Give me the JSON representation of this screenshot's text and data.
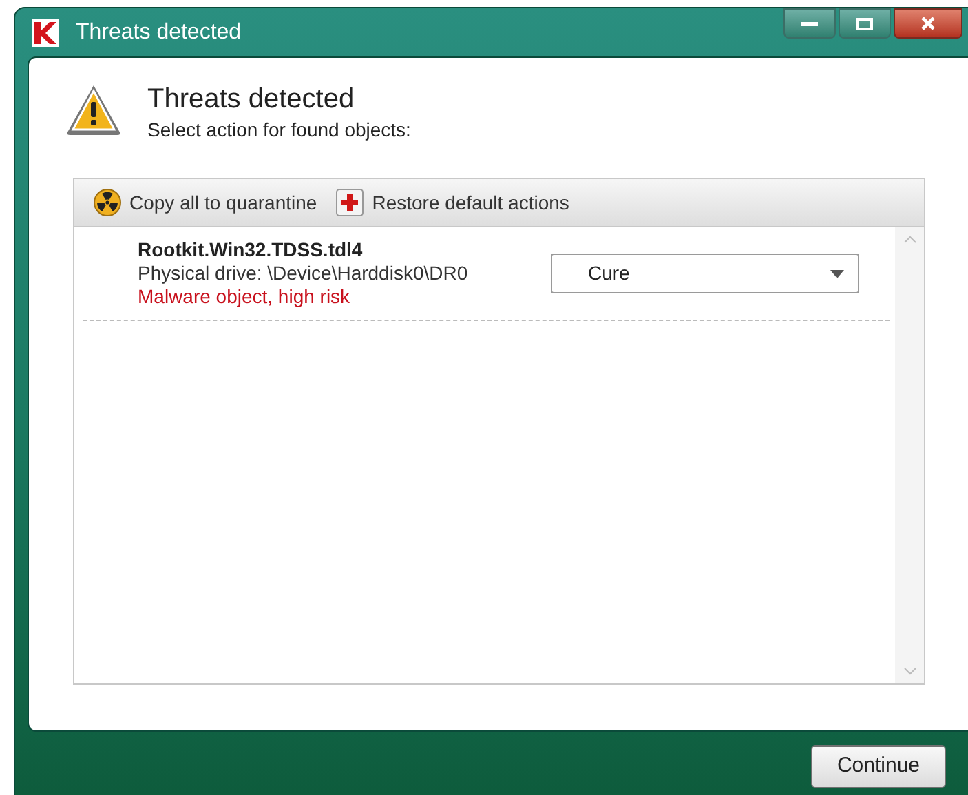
{
  "window": {
    "title": "Threats detected"
  },
  "header": {
    "title": "Threats detected",
    "subtitle": "Select action for found objects:"
  },
  "toolbar": [
    {
      "kind": "quarantine",
      "label": "Copy all to quarantine"
    },
    {
      "kind": "restore",
      "label": "Restore default actions"
    }
  ],
  "threats": [
    {
      "name": "Rootkit.Win32.TDSS.tdl4",
      "location": "Physical drive: \\Device\\Harddisk0\\DR0",
      "risk": "Malware object, high risk",
      "action": "Cure"
    }
  ],
  "buttons": [
    {
      "label": "Continue"
    }
  ]
}
